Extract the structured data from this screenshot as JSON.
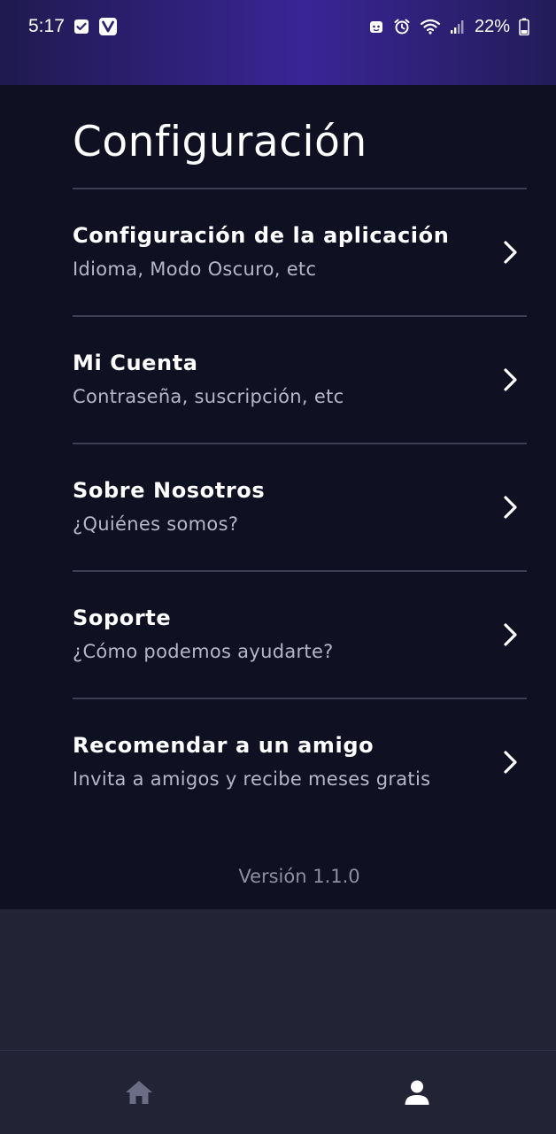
{
  "status_bar": {
    "time": "5:17",
    "battery": "22%",
    "left_icons": [
      "check-notification-icon",
      "vpn-v-icon"
    ],
    "right_icons": [
      "android-icon",
      "alarm-icon",
      "wifi-icon",
      "signal-icon",
      "battery-icon"
    ]
  },
  "page": {
    "title": "Configuración",
    "version": "Versión 1.1.0"
  },
  "settings": [
    {
      "title": "Configuración de la aplicación",
      "subtitle": "Idioma, Modo Oscuro, etc"
    },
    {
      "title": "Mi Cuenta",
      "subtitle": "Contraseña, suscripción, etc"
    },
    {
      "title": "Sobre Nosotros",
      "subtitle": "¿Quiénes somos?"
    },
    {
      "title": "Soporte",
      "subtitle": "¿Cómo podemos ayudarte?"
    },
    {
      "title": "Recomendar a un amigo",
      "subtitle": "Invita a amigos y recibe meses gratis"
    }
  ],
  "bottom_nav": {
    "items": [
      {
        "icon": "home-icon",
        "active": false
      },
      {
        "icon": "profile-icon",
        "active": true
      }
    ]
  },
  "colors": {
    "background": "#0f1022",
    "header_gradient_accent": "#3a2596",
    "nav_background": "#222436",
    "divider": "#3d3e52",
    "subtitle_text": "#b6b7c6",
    "inactive_icon": "#6b6d86",
    "active_icon": "#ffffff"
  }
}
